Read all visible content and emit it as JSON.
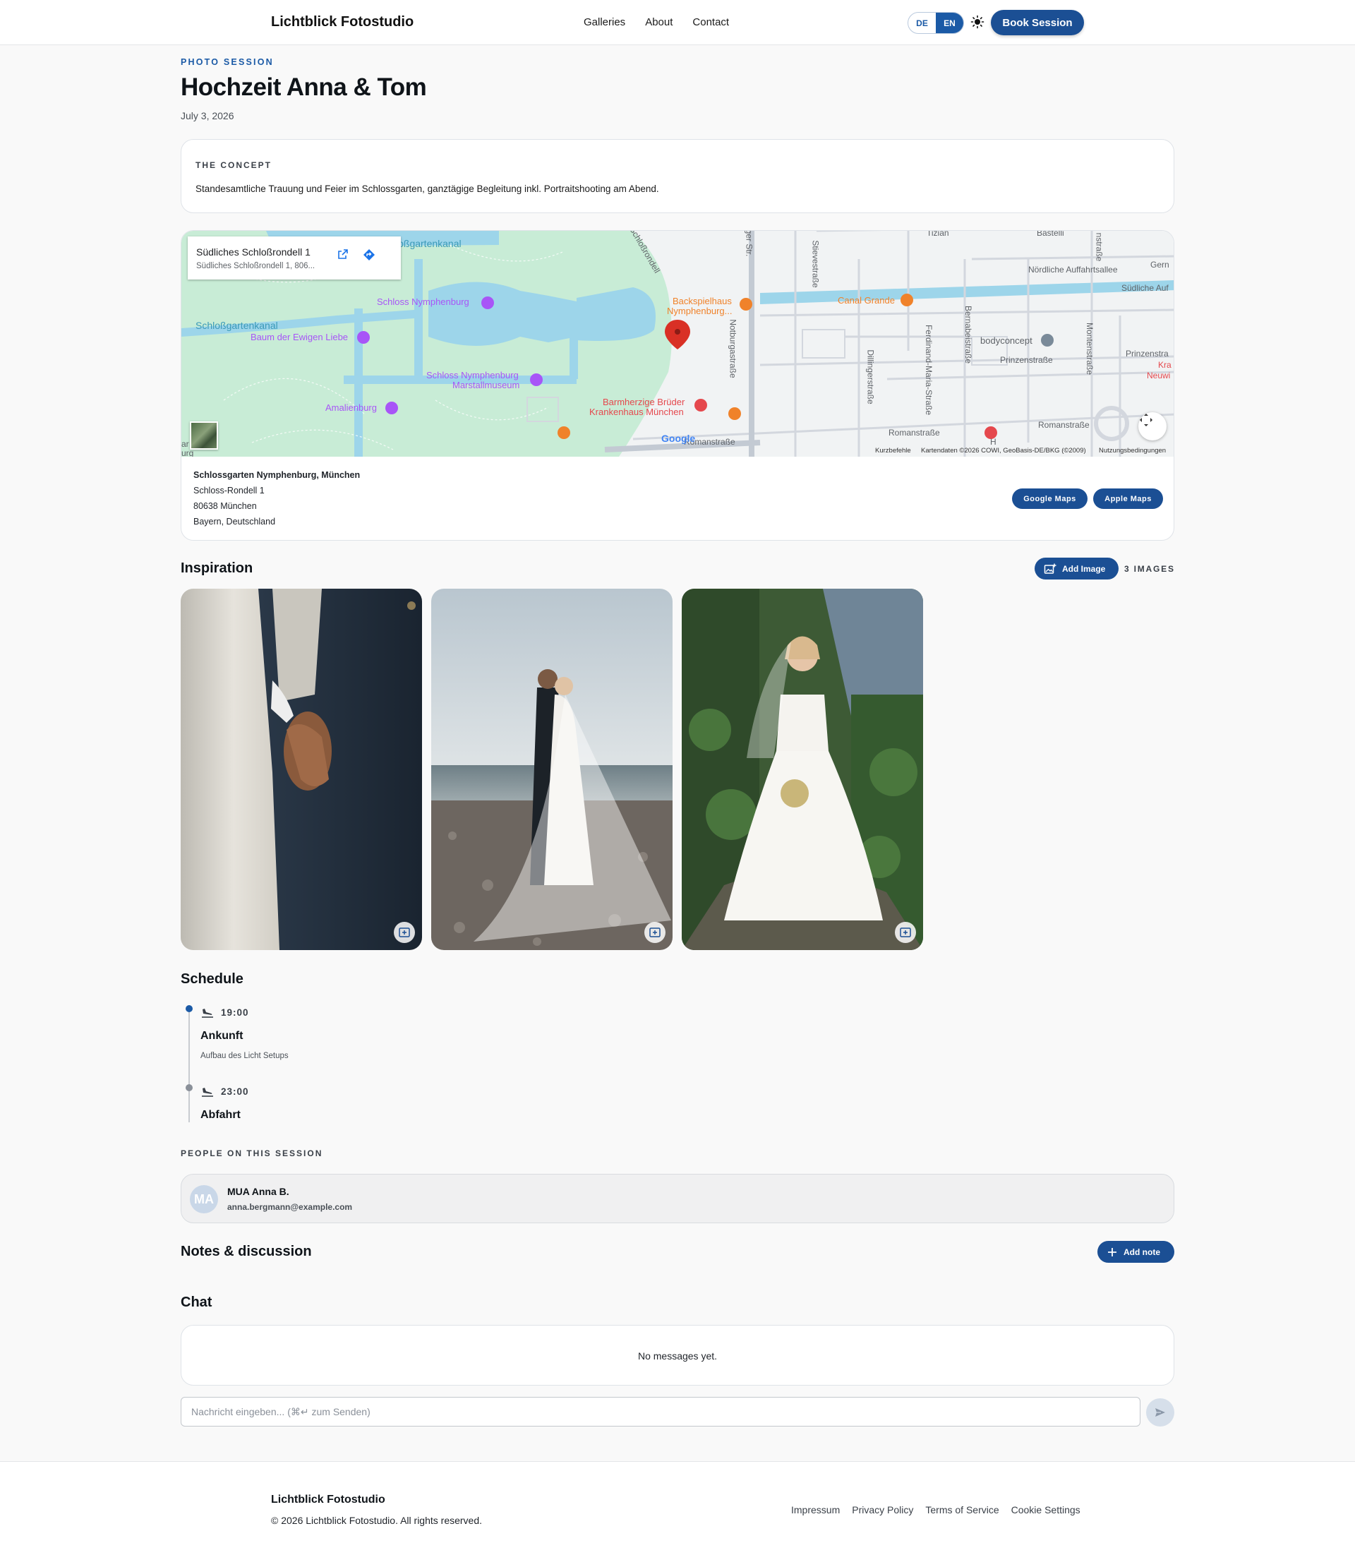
{
  "header": {
    "brand": "Lichtblick Fotostudio",
    "nav": [
      "Galleries",
      "About",
      "Contact"
    ],
    "lang": [
      "DE",
      "EN"
    ],
    "lang_active": "EN",
    "book_label": "Book Session",
    "theme_icon": "sun-icon"
  },
  "hero": {
    "eyebrow": "PHOTO SESSION",
    "title": "Hochzeit Anna & Tom",
    "date": "July 3, 2026"
  },
  "concept": {
    "label": "THE CONCEPT",
    "text": "Standesamtliche Trauung und Feier im Schlossgarten, ganztägige Begleitung inkl. Portraitshooting am Abend."
  },
  "map": {
    "info_title": "Südliches Schloßrondell 1",
    "info_subtitle": "Südliches Schloßrondell 1, 806...",
    "labels": {
      "schlossgartenkanal_top": "loßgartenkanal",
      "schlossgartenkanal_left": "Schloßgartenkanal",
      "schloss": "Schloss Nymphenburg",
      "baum": "Baum der Ewigen Liebe",
      "marstall_1": "Schloss Nymphenburg",
      "marstall_2": "Marstallmuseum",
      "amalienburg": "Amalienburg",
      "backspielhaus_1": "Backspielhaus",
      "backspielhaus_2": "Nymphenburg...",
      "canal_grande": "Canal Grande",
      "barmherzige_1": "Barmherzige Brüder",
      "barmherzige_2": "Krankenhaus München",
      "bodyconcept": "bodyconcept",
      "prinzenstr": "Prinzenstraße",
      "prinzenstr_right": "Prinzenstra",
      "kran": "Kra",
      "neuwi": "Neuwi",
      "nord": "Nördliche Auffahrtsallee",
      "sued": "Südliche Auf",
      "gern": "Gern",
      "romanstr_1": "Romanstraße",
      "romanstr_2": "Romanstraße",
      "romanstr_3": "Romanstraße",
      "notburgastr": "Notburgastraße",
      "stievestr": "Stievestraße",
      "dillingerstr": "Dillingerstraße",
      "ferdinand": "Ferdinand-Maria-Straße",
      "bernabeistr": "Bernabeistraße",
      "montenstr": "Montenstraße",
      "schlossrondell": "Schloßrondell",
      "ger_str": "ger Str.",
      "nstrasse": "nstraße",
      "fizian": "Tizian",
      "bastelli": "Bastelli",
      "ar": "ar",
      "urg": "urg",
      "h": "H",
      "google": "Google"
    },
    "credits": [
      "Kurzbefehle",
      "Kartendaten ©2026 COWI, GeoBasis-DE/BKG (©2009)",
      "Nutzungsbedingungen"
    ],
    "address": {
      "name": "Schlossgarten Nymphenburg, München",
      "street": "Schloss-Rondell 1",
      "city": "80638 München",
      "region": "Bayern, Deutschland"
    },
    "buttons": {
      "google": "Google Maps",
      "apple": "Apple Maps"
    }
  },
  "inspiration": {
    "title": "Inspiration",
    "add_label": "Add Image",
    "count": "3 IMAGES"
  },
  "schedule": {
    "title": "Schedule",
    "items": [
      {
        "time": "19:00",
        "title": "Ankunft",
        "desc": "Aufbau des Licht Setups",
        "icon": "plane-landing-icon"
      },
      {
        "time": "23:00",
        "title": "Abfahrt",
        "desc": "",
        "icon": "plane-landing-icon"
      }
    ]
  },
  "people": {
    "label": "PEOPLE ON THIS SESSION",
    "items": [
      {
        "initials": "MA",
        "name": "MUA Anna B.",
        "email": "anna.bergmann@example.com"
      }
    ]
  },
  "notes": {
    "title": "Notes & discussion",
    "add_label": "Add note"
  },
  "chat": {
    "title": "Chat",
    "empty": "No messages yet.",
    "placeholder": "Nachricht eingeben... (⌘↵ zum Senden)"
  },
  "footer": {
    "brand": "Lichtblick Fotostudio",
    "copyright": "© 2026 Lichtblick Fotostudio. All rights reserved.",
    "links": [
      "Impressum",
      "Privacy Policy",
      "Terms of Service",
      "Cookie Settings"
    ]
  },
  "colors": {
    "accent": "#1b4f94",
    "accent_light": "#1b5aa6",
    "park": "#c8ecd6",
    "water": "#9dd5ea",
    "pin": "#d93025"
  }
}
